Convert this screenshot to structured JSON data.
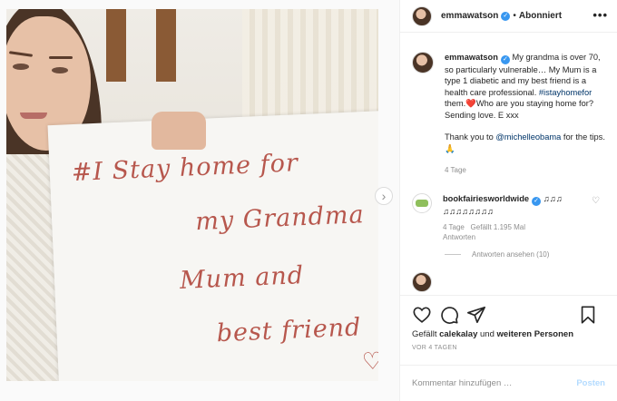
{
  "post": {
    "sign_lines": [
      "#I Stay home for",
      "my Grandma",
      "Mum and",
      "best friend"
    ]
  },
  "header": {
    "username": "emmawatson",
    "separator": "•",
    "follow_label": "Abonniert",
    "more_label": "•••"
  },
  "caption": {
    "username": "emmawatson",
    "text_before_tag": "My grandma is over 70, so particularly vulnerable… My Mum is a type 1 diabetic and my best friend is a health care professional.",
    "hashtag": "#istayhomefor",
    "text_after_tag": "them.❤️Who are you staying home for?  Sending love. E xxx",
    "thanks_before": "Thank you to",
    "mention": "@michelleobama",
    "thanks_after": "for the tips. 🙏",
    "age": "4 Tage"
  },
  "comment": {
    "username": "bookfairiesworldwide",
    "text": "♫♫♫ ♫♫♫♫♫♫♫♫",
    "age": "4 Tage",
    "likes": "Gefällt 1.195 Mal",
    "reply_label": "Antworten",
    "view_replies": "Antworten ansehen (10)"
  },
  "actions": {
    "likes_prefix": "Gefällt",
    "liker": "calekalay",
    "likes_mid": "und",
    "likes_others": "weiteren Personen",
    "timestamp": "VOR 4 TAGEN"
  },
  "comment_box": {
    "placeholder": "Kommentar hinzufügen …",
    "post_label": "Posten"
  },
  "icons": {
    "heart": "heart-icon",
    "comment": "comment-icon",
    "share": "share-icon",
    "bookmark": "bookmark-icon",
    "verified": "verified-badge-icon",
    "next": "chevron-right-icon"
  },
  "colors": {
    "verified": "#3897f0",
    "link": "#003569",
    "post_button": "#b3dbff",
    "sign_ink": "#b7574d"
  }
}
